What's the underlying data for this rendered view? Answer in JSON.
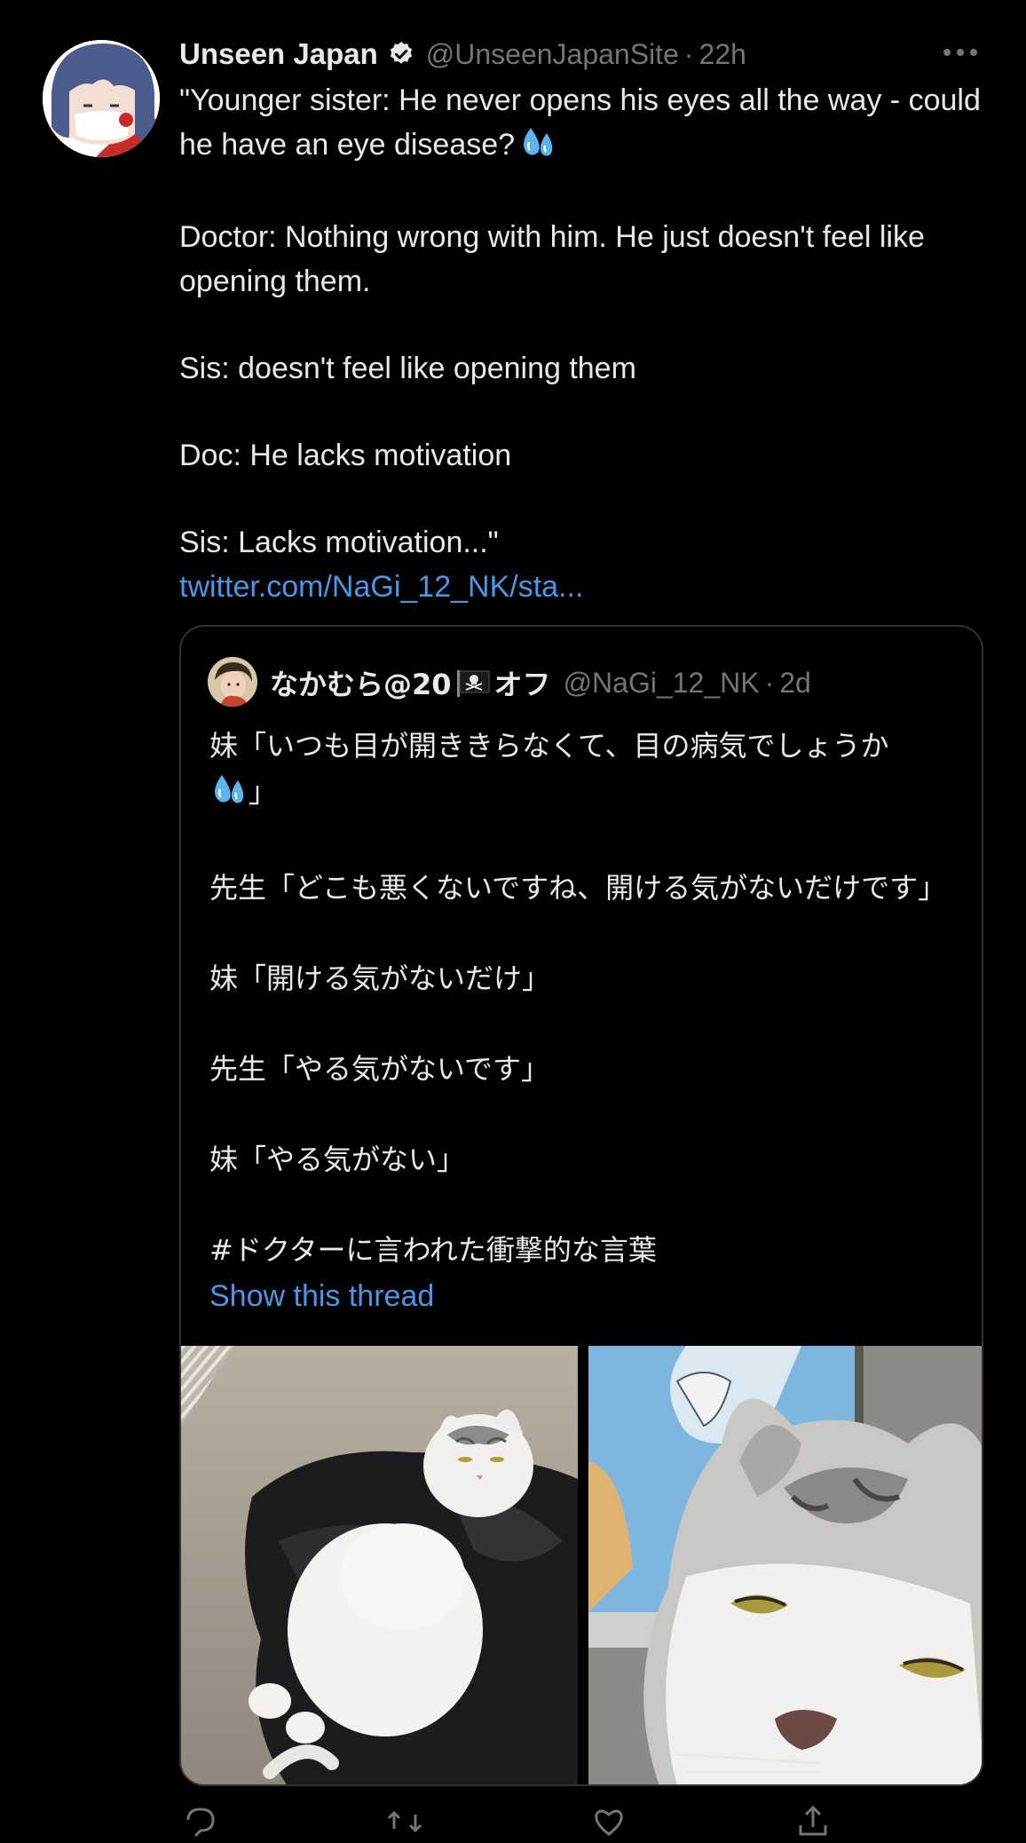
{
  "tweet": {
    "author": {
      "display_name": "Unseen Japan",
      "handle": "@UnseenJapanSite",
      "time": "22h",
      "separator": "·",
      "verified": true
    },
    "text": {
      "line1": "\"Younger sister: He never opens his eyes all the way - could he have an eye disease?",
      "line2": "Doctor: Nothing wrong with him. He just doesn't feel like opening them.",
      "line3": "Sis: doesn't feel like opening them",
      "line4": "Doc: He lacks motivation",
      "line5": "Sis: Lacks motivation...\"",
      "link": "twitter.com/NaGi_12_NK/sta..."
    },
    "more_icon": "more-horizontal-icon"
  },
  "quote": {
    "author": {
      "name_prefix": "なかむら@20",
      "name_suffix": "オフ",
      "handle": "@NaGi_12_NK",
      "separator": "·",
      "time": "2d"
    },
    "text": {
      "line1": "妹「いつも目が開ききらなくて、目の病気でしょうか",
      "line1_end": "」",
      "line2": "先生「どこも悪くないですね、開ける気がないだけです」",
      "line3": "妹「開ける気がないだけ」",
      "line4": "先生「やる気がないです」",
      "line5": "妹「やる気がない」",
      "line6": " #ドクターに言われた衝撃的な言葉"
    },
    "show_thread": "Show this thread",
    "media": [
      {
        "alt": "cat-lying-on-black-cushion-photo"
      },
      {
        "alt": "cat-closeup-photo"
      }
    ]
  },
  "actions": {
    "icons": [
      "reply-icon",
      "retweet-icon",
      "like-icon",
      "share-icon"
    ]
  },
  "colors": {
    "background": "#000000",
    "text": "#e7e9ea",
    "secondary": "#71767b",
    "link": "#4a97e8",
    "border": "#2f3336"
  }
}
